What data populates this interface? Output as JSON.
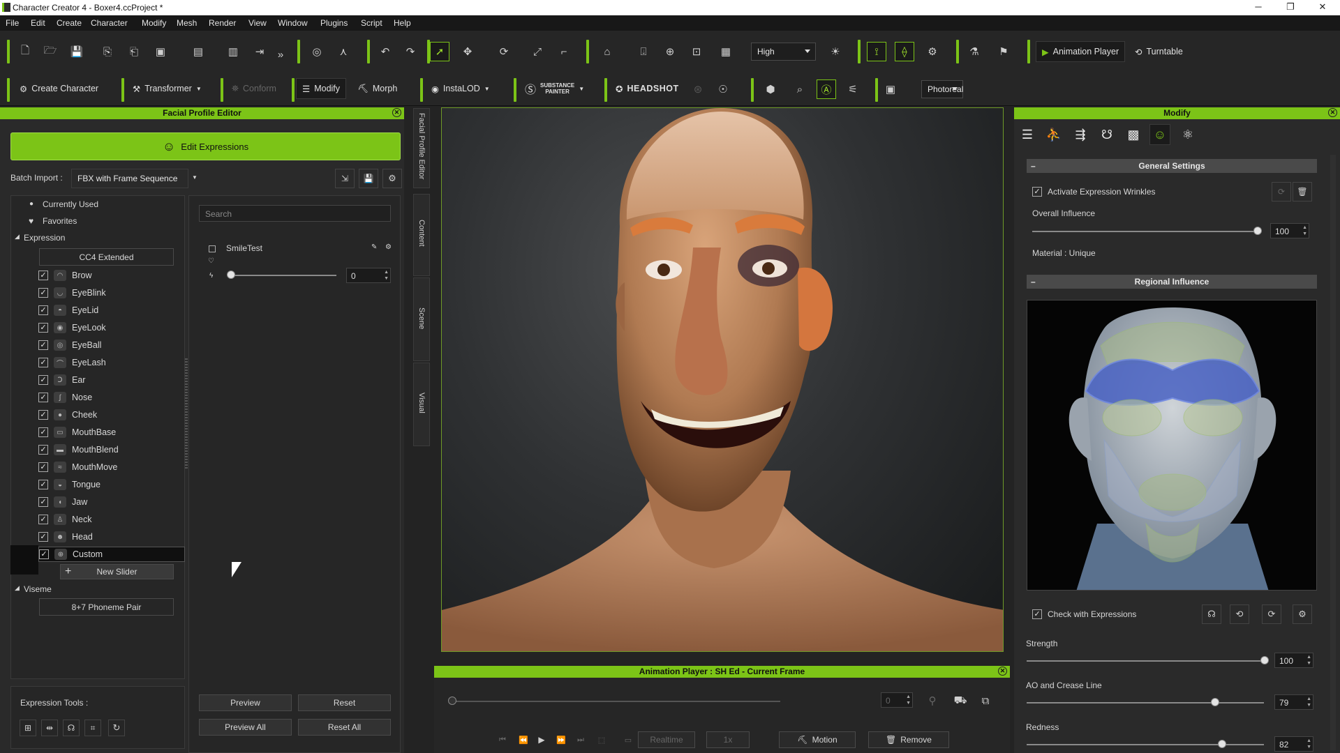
{
  "window": {
    "title": "Character Creator 4 - Boxer4.ccProject *",
    "minimize": "─",
    "maximize": "❐",
    "close": "✕"
  },
  "menu": [
    "File",
    "Edit",
    "Create",
    "Character",
    "Modify",
    "Mesh",
    "Render",
    "View",
    "Window",
    "Plugins",
    "Script",
    "Help"
  ],
  "toolbar": {
    "quality": "High",
    "animation_player": "Animation Player",
    "turntable": "Turntable",
    "create_character": "Create Character",
    "transformer": "Transformer",
    "conform": "Conform",
    "modify": "Modify",
    "morph": "Morph",
    "instalod": "InstaLOD",
    "substance": "SUBSTANCE",
    "painter": "PAINTER",
    "headshot": "HEADSHOT",
    "render_mode": "Photoreal"
  },
  "facial_profile": {
    "title": "Facial Profile Editor",
    "edit_expressions": "Edit Expressions",
    "batch_import_label": "Batch Import :",
    "batch_import_value": "FBX with Frame Sequence",
    "currently_used": "Currently Used",
    "favorites": "Favorites",
    "expression_header": "Expression",
    "cc4_extended": "CC4 Extended",
    "categories": [
      "Brow",
      "EyeBlink",
      "EyeLid",
      "EyeLook",
      "EyeBall",
      "EyeLash",
      "Ear",
      "Nose",
      "Cheek",
      "MouthBase",
      "MouthBlend",
      "MouthMove",
      "Tongue",
      "Jaw",
      "Neck",
      "Head",
      "Custom"
    ],
    "new_slider": "New Slider",
    "viseme_header": "Viseme",
    "phoneme_pair": "8+7 Phoneme Pair",
    "expression_tools": "Expression Tools :",
    "search_placeholder": "Search",
    "slider_item": "SmileTest",
    "slider_value": "0",
    "preview": "Preview",
    "reset": "Reset",
    "preview_all": "Preview All",
    "reset_all": "Reset All"
  },
  "side_tabs": [
    "Facial Profile Editor",
    "Content",
    "Scene",
    "Visual"
  ],
  "animation_player": {
    "title": "Animation Player : SH Ed - Current Frame",
    "frame": "0",
    "realtime": "Realtime",
    "speed": "1x",
    "motion": "Motion",
    "remove": "Remove"
  },
  "modify": {
    "title": "Modify",
    "general_settings": "General Settings",
    "activate_wrinkles": "Activate Expression Wrinkles",
    "overall_influence": "Overall Influence",
    "overall_value": "100",
    "overall_level": 1.0,
    "material": "Material : Unique",
    "regional_influence": "Regional Influence",
    "check_with_expressions": "Check with Expressions",
    "strength": "Strength",
    "strength_value": "100",
    "strength_level": 1.0,
    "ao_crease": "AO and Crease Line",
    "ao_value": "79",
    "ao_level": 0.79,
    "redness": "Redness",
    "redness_value": "82",
    "redness_level": 0.82
  },
  "colors": {
    "accent": "#7cc417",
    "panel": "#2a2a2a",
    "dark": "#1b1b1b",
    "region_blue": "#4a63c4",
    "region_green": "#8fae5a"
  }
}
